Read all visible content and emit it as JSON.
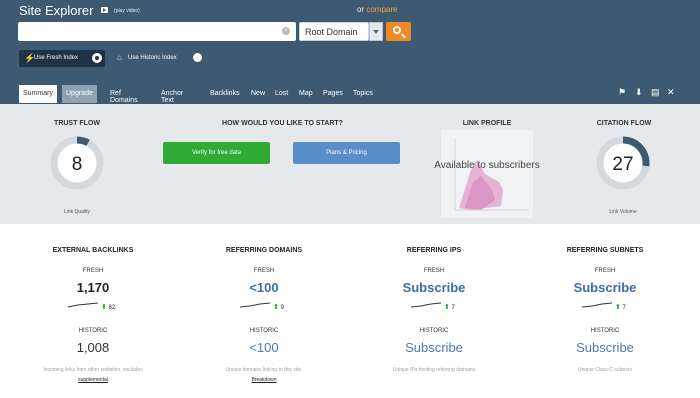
{
  "header": {
    "title": "Site Explorer",
    "play_video": "(play video)",
    "or": "or",
    "compare": "compare",
    "search": {
      "value": "",
      "placeholder": ""
    },
    "scope": {
      "selected": "Root Domain"
    },
    "fresh_index": "Use Fresh Index",
    "historic_index": "Use Historic Index"
  },
  "tabs": [
    {
      "label": "Summary"
    },
    {
      "label": "Upgrade"
    },
    {
      "label": "Ref Domains"
    },
    {
      "label": "Anchor Text"
    },
    {
      "label": "Backlinks"
    },
    {
      "label": "New"
    },
    {
      "label": "Lost"
    },
    {
      "label": "Map"
    },
    {
      "label": "Pages"
    },
    {
      "label": "Topics"
    }
  ],
  "toolbar_icons": [
    "bookmark-add-icon",
    "download-icon",
    "report-icon",
    "tools-icon"
  ],
  "summary": {
    "trust_flow": {
      "label": "TRUST FLOW",
      "value": "8",
      "sub": "Link Quality",
      "fraction": 0.08,
      "color": "#3d5a72"
    },
    "start": {
      "label": "HOW WOULD YOU LIKE TO START?",
      "verify": "Verify for free data",
      "plans": "Plans & Pricing"
    },
    "link_profile": {
      "label": "LINK PROFILE",
      "overlay": "Available to subscribers"
    },
    "citation_flow": {
      "label": "CITATION FLOW",
      "value": "27",
      "sub": "Link Volume",
      "fraction": 0.27,
      "color": "#3d5a72"
    }
  },
  "stats": [
    {
      "heading": "EXTERNAL BACKLINKS",
      "fresh_label": "FRESH",
      "fresh_value": "1,170",
      "delta": "82",
      "historic_label": "HISTORIC",
      "historic_value": "1,008",
      "desc": "Incoming links from other websites, excludes",
      "desc_link": "supplemental"
    },
    {
      "heading": "REFERRING DOMAINS",
      "fresh_label": "FRESH",
      "fresh_value": "<100",
      "delta": "9",
      "historic_label": "HISTORIC",
      "historic_value": "<100",
      "desc": "Unique domains linking to this site.",
      "desc_link": "Breakdown"
    },
    {
      "heading": "REFERRING IPS",
      "fresh_label": "FRESH",
      "fresh_value": "Subscribe",
      "delta": "7",
      "historic_label": "HISTORIC",
      "historic_value": "Subscribe",
      "desc": "Unique IPs hosting referring domains",
      "desc_link": ""
    },
    {
      "heading": "REFERRING SUBNETS",
      "fresh_label": "FRESH",
      "fresh_value": "Subscribe",
      "delta": "7",
      "historic_label": "HISTORIC",
      "historic_value": "Subscribe",
      "desc": "Unique Class-C subnets",
      "desc_link": ""
    }
  ]
}
